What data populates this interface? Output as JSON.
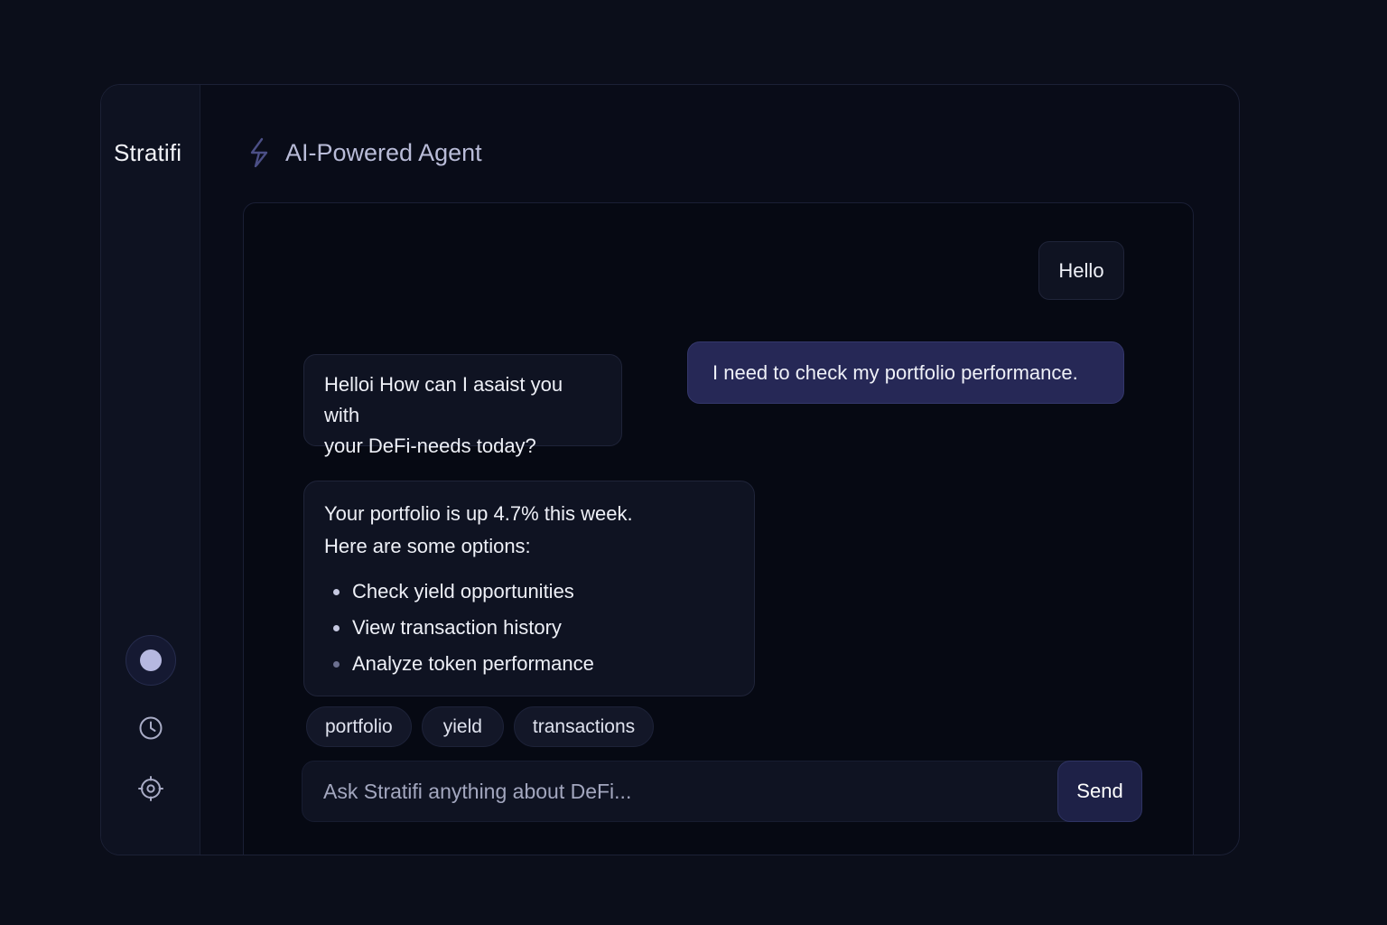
{
  "sidebar": {
    "brand": "Stratifi",
    "nav": [
      {
        "icon": "home-dot-icon",
        "active": true
      },
      {
        "icon": "clock-icon",
        "active": false
      },
      {
        "icon": "gear-icon",
        "active": false
      }
    ]
  },
  "header": {
    "icon": "lightning-bolt-icon",
    "title": "AI-Powered Agent"
  },
  "chat": {
    "messages": [
      {
        "role": "user",
        "text": "Hello"
      },
      {
        "role": "user",
        "text": "I need to check my portfolio performance."
      },
      {
        "role": "assistant",
        "text_line1": "Helloi How can I asaist you with",
        "text_line2": "your DeFi-needs today?"
      },
      {
        "role": "assistant",
        "text_line1": "Your portfolio is up 4.7% this week.",
        "text_line2": "Here are some options:",
        "options": [
          "Check yield opportunities",
          "View transaction history",
          "Analyze token performance"
        ]
      }
    ],
    "chips": [
      "portfolio",
      "yield",
      "transactions"
    ]
  },
  "composer": {
    "placeholder": "Ask Stratifi anything about DeFi...",
    "send_label": "Send"
  },
  "colors": {
    "background": "#0b0e1a",
    "accent": "#262856",
    "active_dot": "#b6b8e0"
  }
}
